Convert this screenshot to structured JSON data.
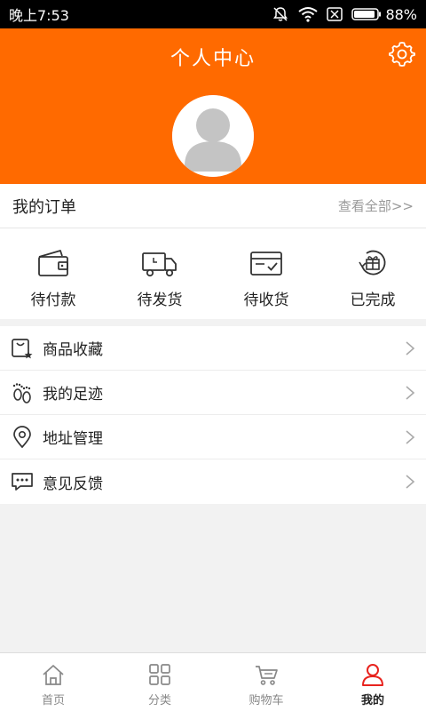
{
  "status_bar": {
    "time": "晚上7:53",
    "battery": "88%"
  },
  "header": {
    "title": "个人中心"
  },
  "orders": {
    "title": "我的订单",
    "view_all": "查看全部>>",
    "items": [
      {
        "label": "待付款",
        "icon": "wallet-icon"
      },
      {
        "label": "待发货",
        "icon": "truck-icon"
      },
      {
        "label": "待收货",
        "icon": "package-check-icon"
      },
      {
        "label": "已完成",
        "icon": "gift-refresh-icon"
      }
    ]
  },
  "menu": {
    "items": [
      {
        "label": "商品收藏",
        "icon": "favorites-bag-icon"
      },
      {
        "label": "我的足迹",
        "icon": "footprints-icon"
      },
      {
        "label": "地址管理",
        "icon": "location-pin-icon"
      },
      {
        "label": "意见反馈",
        "icon": "chat-bubble-icon"
      }
    ]
  },
  "tabbar": {
    "items": [
      {
        "label": "首页",
        "icon": "home-icon"
      },
      {
        "label": "分类",
        "icon": "grid-icon"
      },
      {
        "label": "购物车",
        "icon": "cart-icon"
      },
      {
        "label": "我的",
        "icon": "user-icon",
        "active": true
      }
    ]
  },
  "colors": {
    "brand": "#ff6a00",
    "active_tab": "#e8231e"
  }
}
